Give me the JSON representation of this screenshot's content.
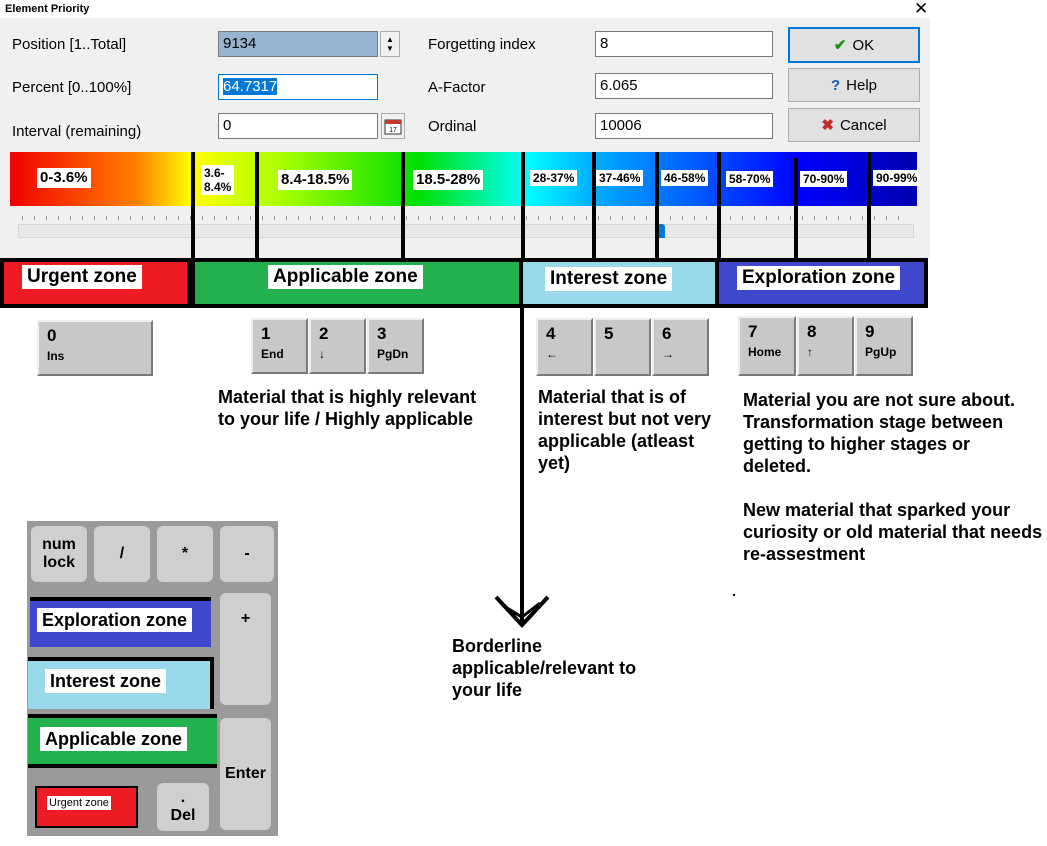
{
  "window": {
    "title": "Element Priority",
    "close_glyph": "✕"
  },
  "fields": {
    "position": {
      "label": "Position [1..Total]",
      "value": "9134"
    },
    "percent": {
      "label": "Percent [0..100%]",
      "value": "64.7317"
    },
    "interval": {
      "label": "Interval (remaining)",
      "value": "0"
    },
    "forgetting": {
      "label": "Forgetting index",
      "value": "8"
    },
    "afactor": {
      "label": "A-Factor",
      "value": "6.065"
    },
    "ordinal": {
      "label": "Ordinal",
      "value": "10006"
    }
  },
  "buttons": {
    "ok": "OK",
    "help": "Help",
    "cancel": "Cancel"
  },
  "calendar_day": "17",
  "priority_bar": {
    "labels": [
      "0-3.6%",
      "3.6-\n8.4%",
      "8.4-18.5%",
      "18.5-28%",
      "28-37%",
      "37-46%",
      "46-58%",
      "58-70%",
      "70-90%",
      "90-99%"
    ],
    "slider_percent": 64.73
  },
  "zones": {
    "urgent": "Urgent zone",
    "applicable": "Applicable zone",
    "interest": "Interest zone",
    "exploration": "Exploration zone"
  },
  "keys": [
    {
      "num": "0",
      "sub": "Ins"
    },
    {
      "num": "1",
      "sub": "End"
    },
    {
      "num": "2",
      "sub": "↓"
    },
    {
      "num": "3",
      "sub": "PgDn"
    },
    {
      "num": "4",
      "sub": "←"
    },
    {
      "num": "5",
      "sub": ""
    },
    {
      "num": "6",
      "sub": "→"
    },
    {
      "num": "7",
      "sub": "Home"
    },
    {
      "num": "8",
      "sub": "↑"
    },
    {
      "num": "9",
      "sub": "PgUp"
    }
  ],
  "descriptions": {
    "applicable": "Material that is highly relevant to your life / Highly applicable",
    "interest": "Material that is of interest but not very applicable (atleast yet)",
    "exploration_1": "Material you are not sure about. Transformation stage between getting to higher stages or deleted.",
    "exploration_2": "New material that sparked your curiosity or old material that needs re-assestment",
    "borderline": "Borderline applicable/relevant to your life"
  },
  "numpad": {
    "numlock": "num lock",
    "slash": "/",
    "star": "*",
    "minus": "-",
    "plus": "+",
    "enter": "Enter",
    "del_dot": ".",
    "del": "Del",
    "exploration": "Exploration zone",
    "interest": "Interest zone",
    "applicable": "Applicable zone",
    "urgent": "Urgent zone"
  },
  "colors": {
    "urgent": "#ed1c24",
    "applicable": "#22b14c",
    "interest": "#99d9ea",
    "exploration": "#3f48cc"
  }
}
